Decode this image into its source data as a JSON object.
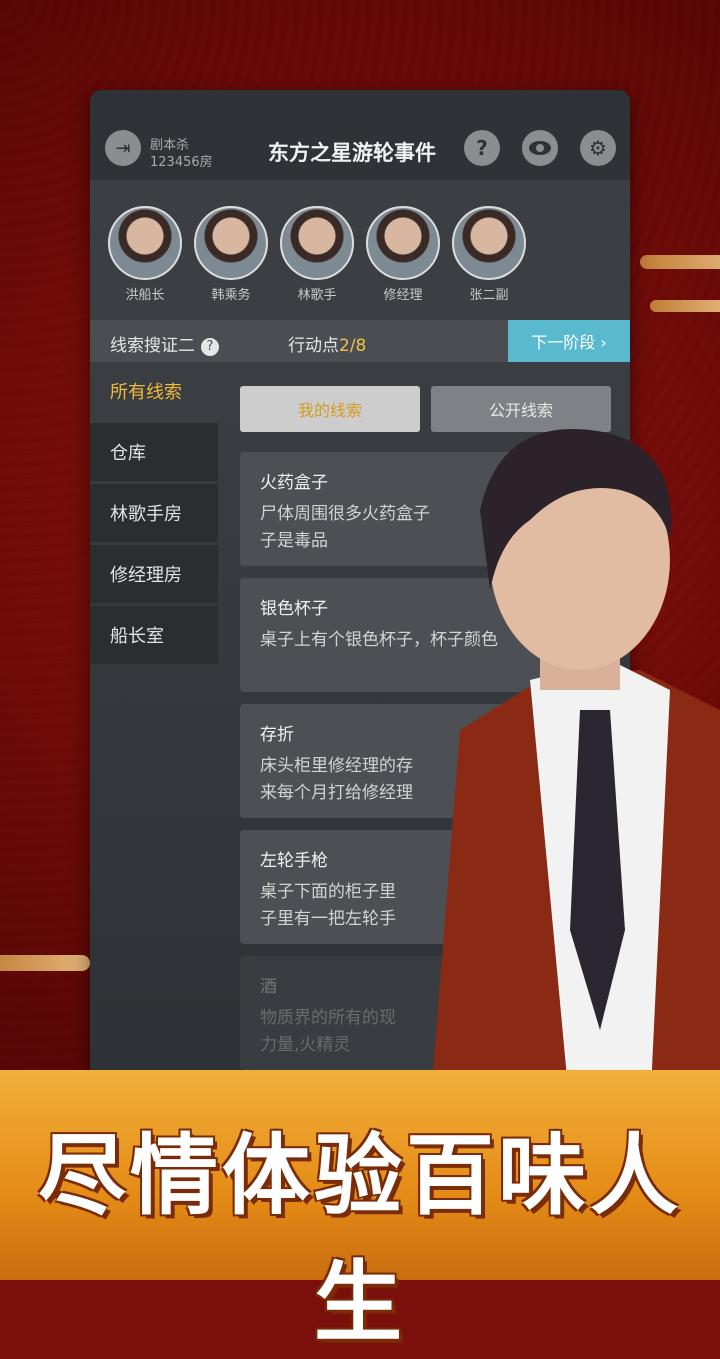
{
  "header": {
    "room_type": "剧本杀",
    "room_number": "123456房",
    "title": "东方之星游轮事件",
    "exit_icon": "exit-icon",
    "help_icon": "?",
    "eye_icon": "eye-icon",
    "settings_icon": "gear-icon"
  },
  "players": [
    {
      "name": "洪船长"
    },
    {
      "name": "韩乘务"
    },
    {
      "name": "林歌手"
    },
    {
      "name": "修经理"
    },
    {
      "name": "张二副"
    }
  ],
  "status": {
    "phase": "线索搜证二",
    "help": "?",
    "action_label": "行动点",
    "action_value": "2/8",
    "next_button": "下一阶段 ›"
  },
  "sidebar": {
    "items": [
      {
        "label": "所有线索"
      },
      {
        "label": "仓库"
      },
      {
        "label": "林歌手房"
      },
      {
        "label": "修经理房"
      },
      {
        "label": "船长室"
      }
    ]
  },
  "tabs": {
    "mine": "我的线索",
    "public": "公开线索"
  },
  "clues": [
    {
      "title": "火药盒子",
      "line1": "尸体周围很多火药盒子",
      "line2": "子是毒品"
    },
    {
      "title": "银色杯子",
      "line1": "桌子上有个银色杯子，杯子颜色",
      "line2": ""
    },
    {
      "title": "存折",
      "line1": "床头柜里修经理的存",
      "line2": "来每个月打给修经理"
    },
    {
      "title": "左轮手枪",
      "line1": "桌子下面的柜子里",
      "line2": "子里有一把左轮手"
    },
    {
      "title": "酒",
      "line1": "物质界的所有的现",
      "line2": "力量,火精灵"
    }
  ],
  "banner": {
    "slogan": "尽情体验百味人生"
  },
  "colors": {
    "accent_gold": "#f0b93c",
    "next_button": "#58b9cf",
    "background_red": "#7a0f0c",
    "banner_orange": "#e48b16"
  }
}
